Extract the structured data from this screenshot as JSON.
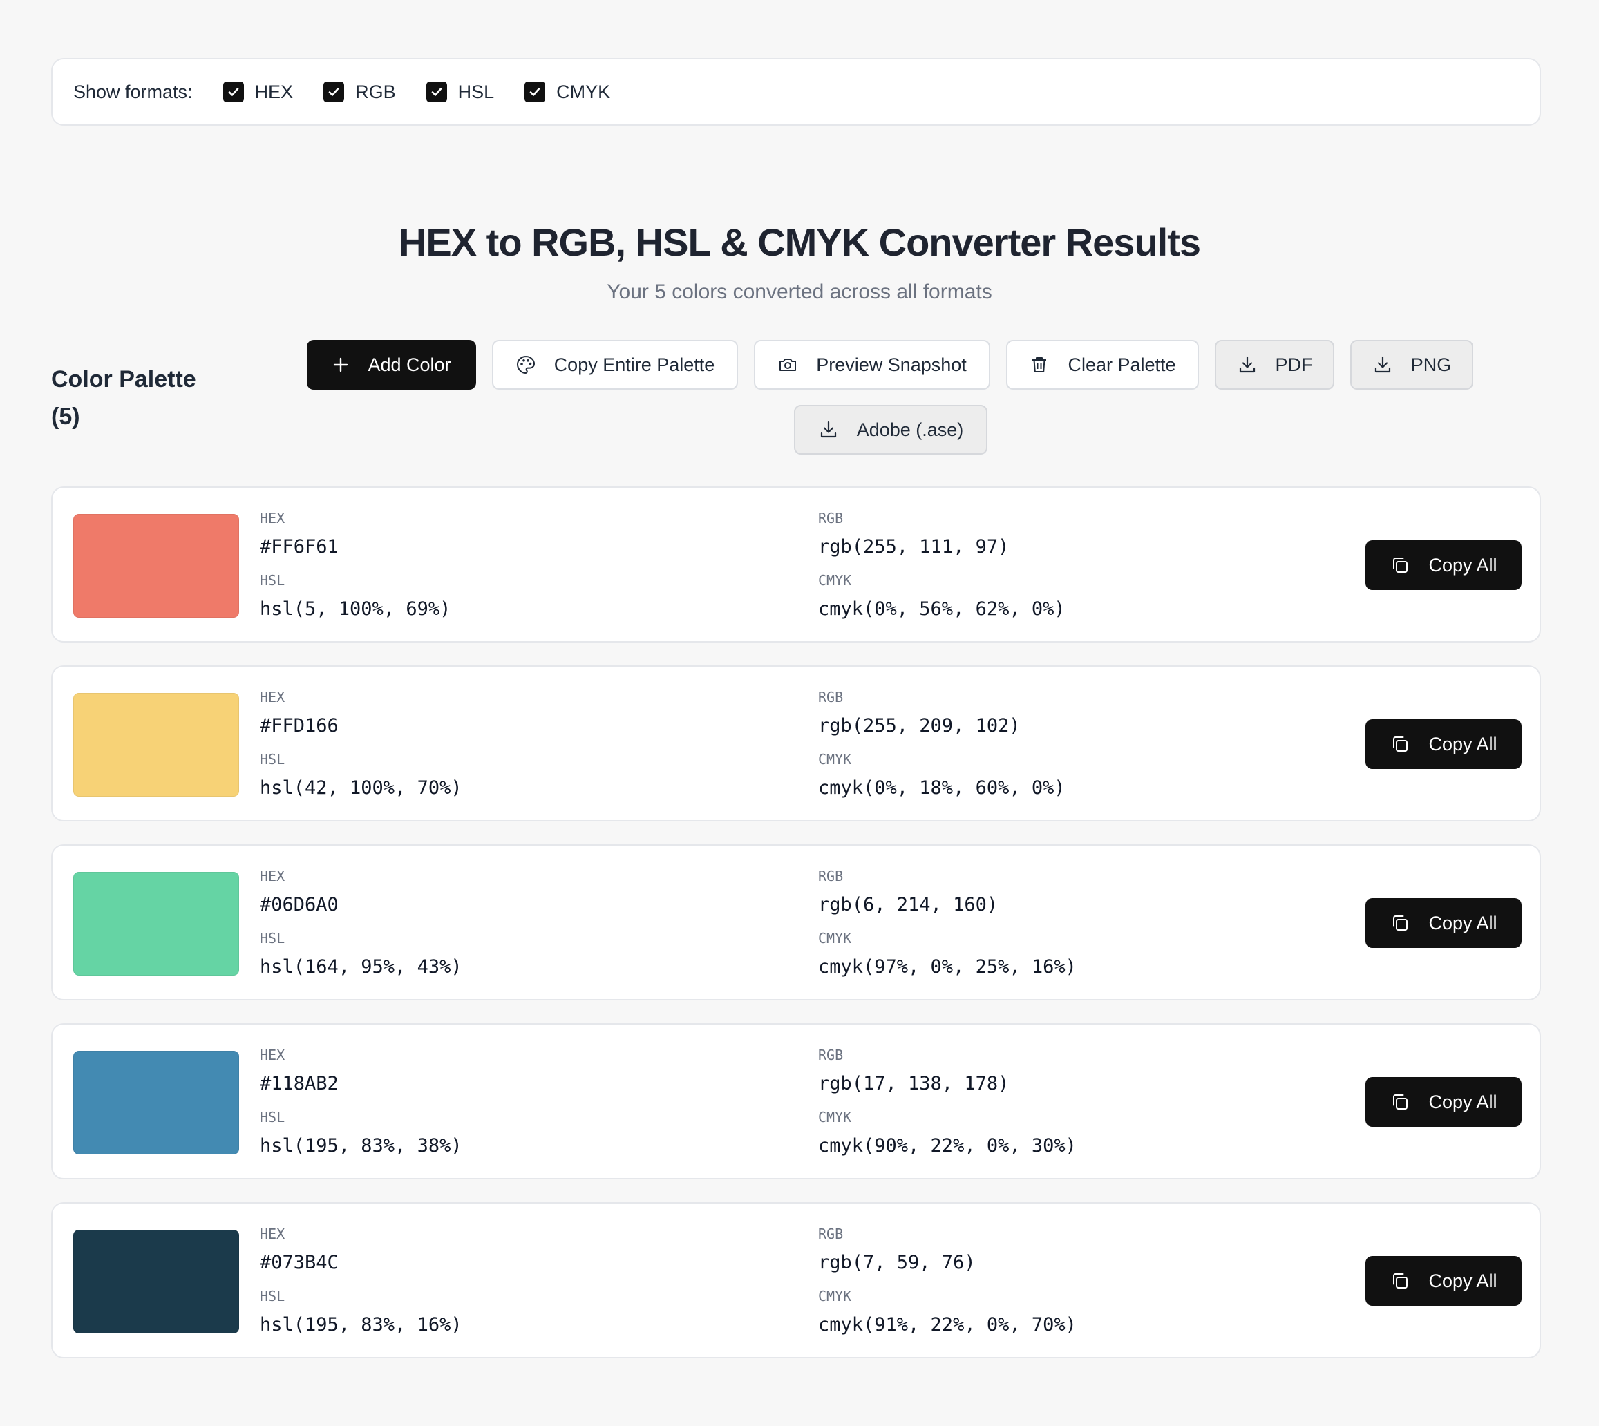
{
  "format_bar": {
    "label": "Show formats:",
    "formats": [
      {
        "label": "HEX",
        "checked": true
      },
      {
        "label": "RGB",
        "checked": true
      },
      {
        "label": "HSL",
        "checked": true
      },
      {
        "label": "CMYK",
        "checked": true
      }
    ]
  },
  "header": {
    "title": "HEX to RGB, HSL & CMYK Converter Results",
    "subtitle": "Your 5 colors converted across all formats"
  },
  "palette": {
    "heading": "Color Palette (5)"
  },
  "toolbar": {
    "add_color": "Add Color",
    "copy_palette": "Copy Entire Palette",
    "preview_snapshot": "Preview Snapshot",
    "clear_palette": "Clear Palette",
    "pdf": "PDF",
    "png": "PNG",
    "adobe": "Adobe (.ase)"
  },
  "labels": {
    "hex": "HEX",
    "rgb": "RGB",
    "hsl": "HSL",
    "cmyk": "CMYK",
    "copy_all": "Copy All"
  },
  "colors": [
    {
      "swatch": "#EF7A69",
      "hex": "#FF6F61",
      "rgb": "rgb(255, 111, 97)",
      "hsl": "hsl(5, 100%, 69%)",
      "cmyk": "cmyk(0%, 56%, 62%, 0%)"
    },
    {
      "swatch": "#F7D276",
      "hex": "#FFD166",
      "rgb": "rgb(255, 209, 102)",
      "hsl": "hsl(42, 100%, 70%)",
      "cmyk": "cmyk(0%, 18%, 60%, 0%)"
    },
    {
      "swatch": "#65D4A4",
      "hex": "#06D6A0",
      "rgb": "rgb(6, 214, 160)",
      "hsl": "hsl(164, 95%, 43%)",
      "cmyk": "cmyk(97%, 0%, 25%, 16%)"
    },
    {
      "swatch": "#438AB2",
      "hex": "#118AB2",
      "rgb": "rgb(17, 138, 178)",
      "hsl": "hsl(195, 83%, 38%)",
      "cmyk": "cmyk(90%, 22%, 0%, 30%)"
    },
    {
      "swatch": "#1B3A4B",
      "hex": "#073B4C",
      "rgb": "rgb(7, 59, 76)",
      "hsl": "hsl(195, 83%, 16%)",
      "cmyk": "cmyk(91%, 22%, 0%, 70%)"
    }
  ]
}
